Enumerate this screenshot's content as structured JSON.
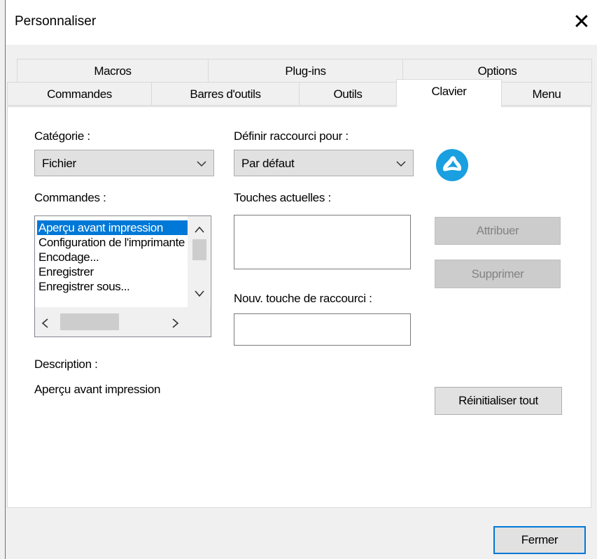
{
  "window": {
    "title": "Personnaliser",
    "close_glyph": "✕"
  },
  "tabs_row1": [
    {
      "label": "Macros"
    },
    {
      "label": "Plug-ins"
    },
    {
      "label": "Options"
    }
  ],
  "tabs_row2": [
    {
      "label": "Commandes"
    },
    {
      "label": "Barres d'outils"
    },
    {
      "label": "Outils"
    },
    {
      "label": "Clavier",
      "active": true
    },
    {
      "label": "Menu"
    }
  ],
  "keyboard": {
    "category_label": "Catégorie :",
    "category_value": "Fichier",
    "define_label": "Définir raccourci pour :",
    "define_value": "Par défaut",
    "commands_label": "Commandes :",
    "commands": [
      "Aperçu avant impression",
      "Configuration de l'imprimante",
      "Encodage...",
      "Enregistrer",
      "Enregistrer sous..."
    ],
    "selected_command_index": 0,
    "current_keys_label": "Touches actuelles :",
    "new_key_label": "Nouv. touche de raccourci :",
    "new_key_value": "",
    "description_label": "Description :",
    "description_text": "Aperçu avant impression",
    "assign_button": "Attribuer",
    "remove_button": "Supprimer",
    "reset_all_button": "Réinitialiser tout",
    "app_icon": "altova-logo-icon"
  },
  "footer": {
    "close_button": "Fermer"
  },
  "colors": {
    "accent": "#0078d7",
    "icon_blue": "#1a9fe0"
  }
}
